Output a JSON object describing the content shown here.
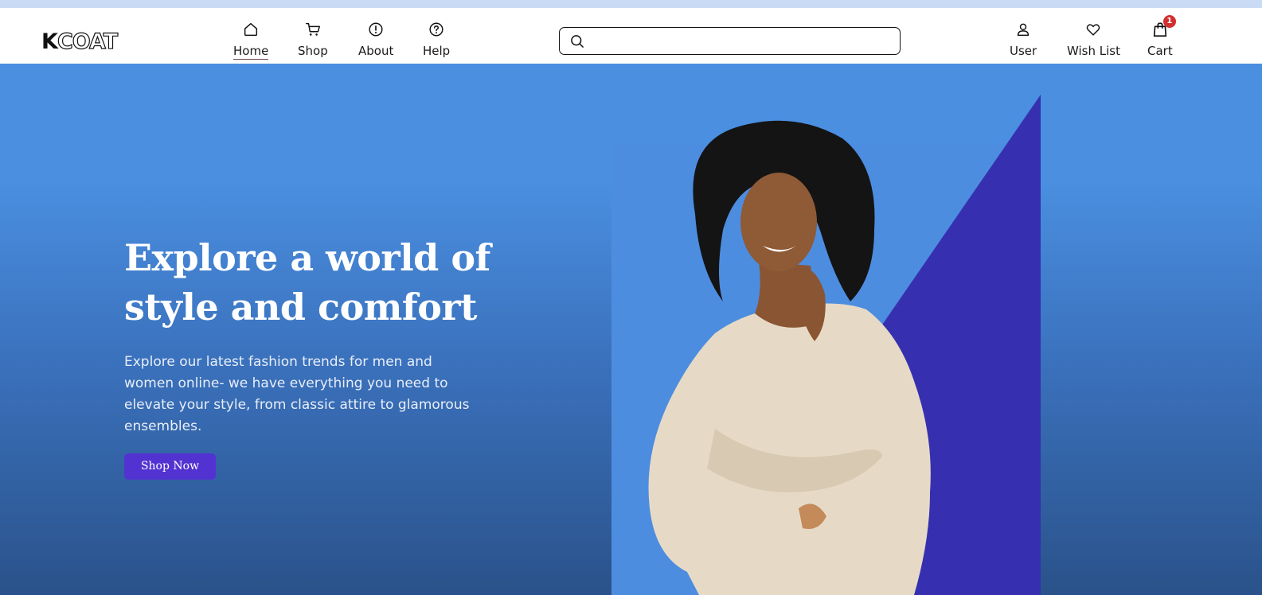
{
  "brand": {
    "logo_solid": "K",
    "logo_outline": "COAT"
  },
  "nav": [
    {
      "label": "Home",
      "icon": "home-icon",
      "active": true
    },
    {
      "label": "Shop",
      "icon": "cart-icon"
    },
    {
      "label": "About",
      "icon": "info-icon"
    },
    {
      "label": "Help",
      "icon": "help-icon"
    }
  ],
  "search": {
    "placeholder": ""
  },
  "account": [
    {
      "label": "User",
      "icon": "user-icon"
    },
    {
      "label": "Wish List",
      "icon": "heart-icon"
    },
    {
      "label": "Cart",
      "icon": "shopping-bag-icon",
      "badge": "1"
    }
  ],
  "hero": {
    "headline": "Explore a world of style and comfort",
    "subtext": "Explore our latest fashion trends for men and women online- we have everything you need to elevate your style, from classic attire to glamorous ensembles.",
    "cta": "Shop Now"
  },
  "colors": {
    "top_strip": "#c9dbf5",
    "hero_top": "#4a8fe0",
    "hero_bottom": "#2a528a",
    "cta": "#5233d1",
    "triangle": "#3630b0",
    "badge": "#d32f2f"
  }
}
